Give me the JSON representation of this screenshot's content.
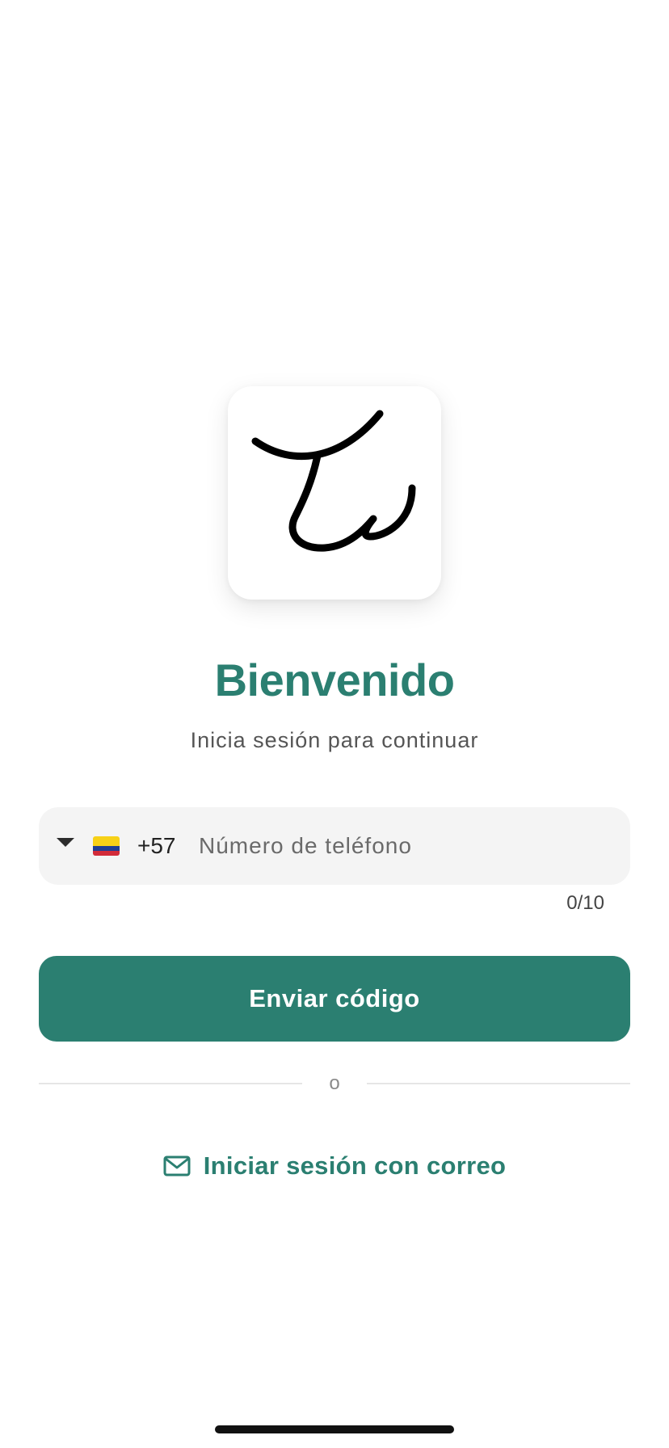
{
  "welcome": {
    "title": "Bienvenido",
    "subtitle": "Inicia sesión para continuar"
  },
  "phone": {
    "country_flag": "colombia-flag",
    "dial_code": "+57",
    "placeholder": "Número de teléfono",
    "value": "",
    "counter": "0/10"
  },
  "actions": {
    "send_code_label": "Enviar código",
    "divider_label": "o",
    "email_login_label": "Iniciar sesión con correo",
    "email_icon": "mail-icon"
  },
  "colors": {
    "brand": "#2b7f71",
    "field_bg": "#f4f4f4",
    "text_muted": "#555555"
  }
}
